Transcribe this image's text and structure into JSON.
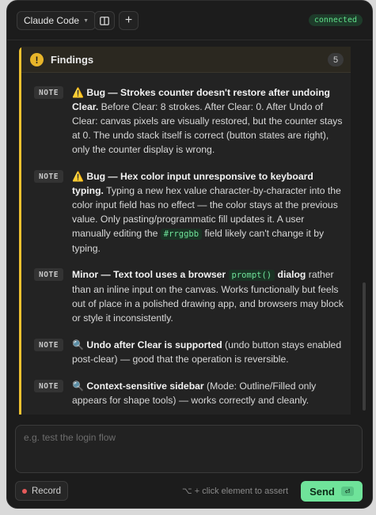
{
  "topbar": {
    "selector_label": "Claude Code",
    "selector_caret_icon": "chevron-down-icon",
    "layout_icon": "columns-icon",
    "add_label": "+",
    "status": "connected"
  },
  "findings": {
    "title": "Findings",
    "count": "5",
    "items": [
      {
        "tag": "NOTE",
        "emoji": "⚠️",
        "bold": "Bug — Strokes counter doesn't restore after undoing Clear.",
        "rest": " Before Clear: 8 strokes. After Clear: 0. After Undo of Clear: canvas pixels are visually restored, but the counter stays at 0. The undo stack itself is correct (button states are right), only the counter display is wrong."
      },
      {
        "tag": "NOTE",
        "emoji": "⚠️",
        "bold": "Bug — Hex color input unresponsive to keyboard typing.",
        "rest_a": " Typing a new hex value character-by-character into the color input field has no effect — the color stays at the previous value. Only pasting/programmatic fill updates it. A user manually editing the ",
        "code": "#rrggbb",
        "rest_b": " field likely can't change it by typing."
      },
      {
        "tag": "NOTE",
        "bold_a": "Minor — Text tool uses a browser ",
        "code": "prompt()",
        "bold_b": " dialog",
        "rest": " rather than an inline input on the canvas. Works functionally but feels out of place in a polished drawing app, and browsers may block or style it inconsistently."
      },
      {
        "tag": "NOTE",
        "emoji": "🔍",
        "bold": "Undo after Clear is supported",
        "rest": " (undo button stays enabled post-clear) — good that the operation is reversible."
      },
      {
        "tag": "NOTE",
        "emoji": "🔍",
        "bold": "Context-sensitive sidebar",
        "rest": " (Mode: Outline/Filled only appears for shape tools) — works correctly and cleanly."
      }
    ]
  },
  "composer": {
    "placeholder": "e.g. test the login flow",
    "record_label": "Record",
    "hint": "⌥ + click element to assert",
    "send_label": "Send",
    "enter_glyph": "⏎"
  },
  "colors": {
    "accent_yellow": "#f2c230",
    "accent_green": "#6fe39a",
    "panel_bg": "#1c1c1c"
  }
}
